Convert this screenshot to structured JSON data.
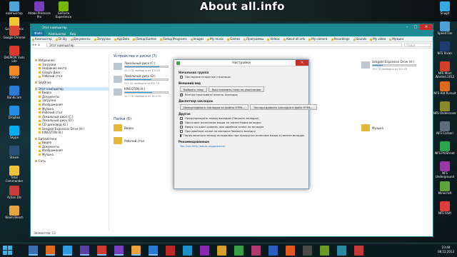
{
  "watermark": "About all.info",
  "desktop_left": [
    {
      "label": "компьютер",
      "color": "#4aa6d9"
    },
    {
      "label": "Google Диск",
      "color": "#f2c531"
    },
    {
      "label": "Adobe Premiere Pro",
      "color": "#7a3dbb"
    },
    {
      "label": "GeForce Experience",
      "color": "#76b900"
    },
    {
      "label": "Google Chrome",
      "color": "#dc4437"
    },
    {
      "label": "DAEMON Tools Lite",
      "color": "#e03a2e"
    },
    {
      "label": "AIMP3",
      "color": "#f08a24"
    },
    {
      "label": "Bandicam",
      "color": "#2b7bd6"
    },
    {
      "label": "Dropbox",
      "color": "#1f8ce6"
    },
    {
      "label": "Skype",
      "color": "#00aff0"
    },
    {
      "label": "Steam",
      "color": "#2b5073"
    },
    {
      "label": "Total Commander",
      "color": "#f0c23a"
    },
    {
      "label": "Action Dis",
      "color": "#c93c3c"
    },
    {
      "label": "Boom Beach",
      "color": "#e6a33e"
    }
  ],
  "desktop_right": [
    {
      "label": "Snagit",
      "color": "#36a9e1"
    },
    {
      "label": "Speed Fan",
      "color": "#50a0d8"
    },
    {
      "label": "NFS Rivals",
      "color": "#1e3c72"
    },
    {
      "label": "NFS Most Wanted 2012",
      "color": "#d4402a"
    },
    {
      "label": "NFS Hot Pursuit",
      "color": "#e06a1e"
    },
    {
      "label": "NFS Undercover",
      "color": "#8a8a2a"
    },
    {
      "label": "NFS Carbon",
      "color": "#5e6e7a"
    },
    {
      "label": "NFS ProStreet",
      "color": "#2aa64c"
    },
    {
      "label": "NFS Underground",
      "color": "#9a38a6"
    },
    {
      "label": "Minecraft",
      "color": "#5ea33a"
    },
    {
      "label": "NFS Shift",
      "color": "#e23b3b"
    }
  ],
  "explorer": {
    "title": "Этот компьютер",
    "menu": [
      "Файл",
      "Компьютер",
      "Вид"
    ],
    "bookmarks": [
      "Компьютер",
      "Dr.Sly",
      "Документы",
      "Загрузки",
      "AppData",
      "[Setup]Games",
      "[Setup]Programs",
      "Images",
      "My music",
      "Games",
      "Программы",
      "Videos",
      "About all.info",
      "My camera",
      "Recordings",
      "Sounds",
      "My video",
      "Музыка"
    ],
    "address": "Этот компьютер",
    "search_placeholder": "Поиск",
    "nav": [
      {
        "label": "Избранное",
        "kind": "h"
      },
      {
        "label": "Загрузки",
        "kind": "in"
      },
      {
        "label": "Недавние места",
        "kind": "in"
      },
      {
        "label": "Google Диск",
        "kind": "in"
      },
      {
        "label": "Рабочий стол",
        "kind": "in"
      },
      {
        "label": "SkyDrive",
        "kind": "h"
      },
      {
        "label": "Этот компьютер",
        "kind": "sel"
      },
      {
        "label": "Видео",
        "kind": "in"
      },
      {
        "label": "Документы",
        "kind": "in"
      },
      {
        "label": "Загрузки",
        "kind": "in"
      },
      {
        "label": "Изображения",
        "kind": "in"
      },
      {
        "label": "Музыка",
        "kind": "in"
      },
      {
        "label": "Рабочий стол",
        "kind": "in"
      },
      {
        "label": "Локальный диск (C:)",
        "kind": "in"
      },
      {
        "label": "Локальный диск (D:)",
        "kind": "in"
      },
      {
        "label": "CD-дисковод (G:)",
        "kind": "in"
      },
      {
        "label": "Seagate Expansion Drive (H:)",
        "kind": "in"
      },
      {
        "label": "KINGSTON (K:)",
        "kind": "in"
      },
      {
        "label": "Библиотеки",
        "kind": "h"
      },
      {
        "label": "Видео",
        "kind": "in"
      },
      {
        "label": "Документы",
        "kind": "in"
      },
      {
        "label": "Изображения",
        "kind": "in"
      },
      {
        "label": "Музыка",
        "kind": "in"
      },
      {
        "label": "Сеть",
        "kind": "h"
      }
    ],
    "devices_header": "Устройства и диски (7)",
    "drives": [
      {
        "name": "Локальный диск (C:)",
        "free": "20,5 ГБ свободно из 100 ГБ",
        "fill": 0.8
      },
      {
        "name": "Локальный диск (D:)",
        "free": "311 ГБ свободно из 831 ГБ",
        "fill": 0.62
      },
      {
        "name": "CD-дисковод (G:)",
        "free": "",
        "fill": null
      },
      {
        "name": "Seagate Expansion Drive (H:)",
        "free": "705 ГБ свободно из 931 ГБ",
        "fill": 0.24
      },
      {
        "name": "KINGSTON (K:)",
        "free": "10,7 ГБ свободно из 28,9 ГБ",
        "fill": 0.63
      }
    ],
    "folders_header": "Папки (6)",
    "folders": [
      "Видео",
      "Рабочий стол",
      "Загрузки",
      "Музыка"
    ],
    "status": "Элементов: 13"
  },
  "dialog": {
    "title": "Настройки",
    "g_start": "Начальная группа",
    "cb_last_pages": "Последние открытые страницы",
    "g_view": "Внешний вид",
    "btn_theme": "Выбрать тему",
    "btn_default_theme": "Восстановить тему по умолчанию",
    "cb_bookmarks_bar": "Всегда показывать панель закладок",
    "g_bookmarks": "Диспетчер закладок",
    "btn_import": "Импортировать закладки из файла HTML...",
    "btn_export": "Экспортировать закладки в файл HTML...",
    "g_other": "Другое",
    "options": [
      {
        "label": "Предупреждать перед выходом (Закрыть вкладки)",
        "checked": false
      },
      {
        "label": "При клике колесиком мыши по папке:Новая вкладка",
        "checked": true
      },
      {
        "label": "Вверх на один уровень при двойном клике по вкладке",
        "checked": false
      },
      {
        "label": "При двойном клике по вкладке:Закрыть вкладку",
        "checked": false
      },
      {
        "label": "Переключаться между вкладками при прокрутке колесика мыши в панели вкладок",
        "checked": true
      }
    ],
    "g_rec": "Рекомендованные",
    "help_link": "You Can Help (ваша поддержка)"
  },
  "taskbar": {
    "apps": [
      {
        "color": "#3a6fb0"
      },
      {
        "color": "#e06a1e"
      },
      {
        "color": "#2f9ee0"
      },
      {
        "color": "#5a3fa0"
      },
      {
        "color": "#d03a30"
      },
      {
        "color": "#7a3dbb"
      },
      {
        "color": "#e8a33a"
      },
      {
        "color": "#2a7ad0"
      },
      {
        "color": "#c02828"
      },
      {
        "color": "#1e90c8"
      },
      {
        "color": "#8a2ab0"
      },
      {
        "color": "#d4a02a"
      },
      {
        "color": "#3aa048"
      },
      {
        "color": "#b03a70"
      },
      {
        "color": "#2a5fc0"
      },
      {
        "color": "#e05a20"
      },
      {
        "color": "#4a4a4a"
      },
      {
        "color": "#6a9a2a"
      },
      {
        "color": "#2a8aa0"
      },
      {
        "color": "#c43a3a"
      }
    ],
    "time": "23:48",
    "date": "08.12.2013"
  }
}
